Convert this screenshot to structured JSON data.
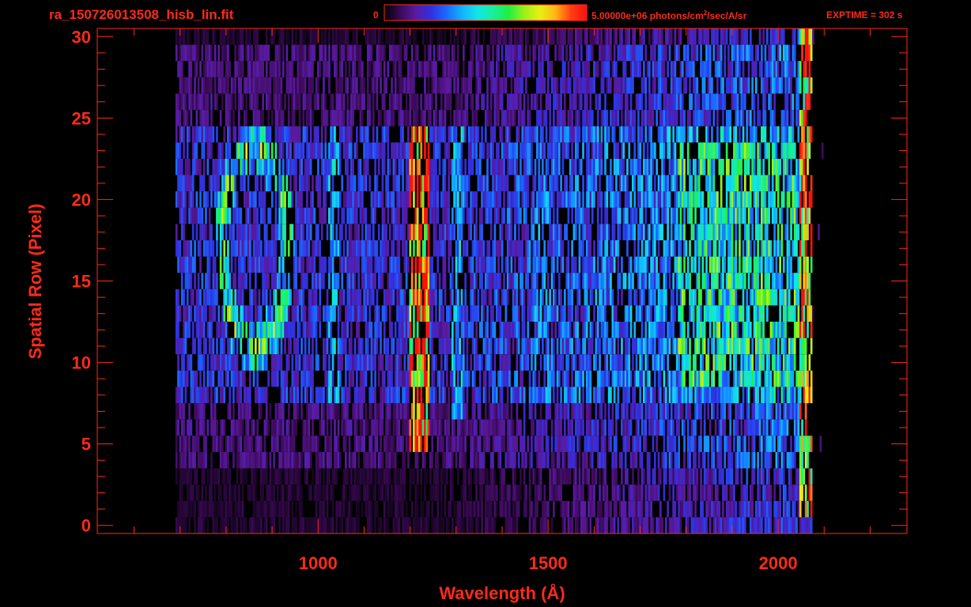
{
  "header": {
    "file_title": "ra_150726013508_hisb_lin.fit",
    "colorbar_min": "0",
    "colorbar_max_value": "5.00000e+06 photons/cm",
    "colorbar_max_exp": "2",
    "colorbar_max_unit": "/sec/A/sr",
    "exptime": "EXPTIME = 302 s"
  },
  "colors": {
    "axis": "#ff2a1a",
    "background": "#000000",
    "colormap": [
      "#000000",
      "#3a0a55",
      "#5a1aa0",
      "#3030e0",
      "#1a6aff",
      "#12b4ff",
      "#10e6e6",
      "#18ee9a",
      "#20f040",
      "#9cf018",
      "#e8f012",
      "#ffb414",
      "#ff3d10",
      "#ff1010"
    ]
  },
  "chart_data": {
    "type": "heatmap",
    "title": "",
    "xlabel": "Wavelength (Å)",
    "ylabel": "Spatial Row (Pixel)",
    "xlim": [
      520,
      2280
    ],
    "ylim": [
      -0.5,
      30.5
    ],
    "xticks_major": [
      1000,
      1500,
      2000
    ],
    "xtick_labels": [
      "1000",
      "1500",
      "2000"
    ],
    "xticks_minor": [
      600,
      700,
      800,
      900,
      1100,
      1200,
      1300,
      1400,
      1600,
      1700,
      1800,
      1900,
      2100,
      2200
    ],
    "yticks_major": [
      0,
      5,
      10,
      15,
      20,
      25,
      30
    ],
    "ytick_labels": [
      "0",
      "5",
      "10",
      "15",
      "20",
      "25",
      "30"
    ],
    "color_range": [
      0,
      5000000
    ],
    "color_unit": "photons/cm²/sec/A/sr",
    "detector_wavelength_range": [
      690,
      2070
    ],
    "features": [
      {
        "label": "bright vertical emission band",
        "wavelength_range": [
          1195,
          1240
        ],
        "rows": [
          5,
          24
        ],
        "intensity": 0.95
      },
      {
        "label": "ring-shaped emission",
        "center_wavelength": 860,
        "center_row": 17,
        "radius_wavelength": 75,
        "radius_rows": 6.5,
        "intensity": 0.55
      },
      {
        "label": "vertical emission band",
        "wavelength_range": [
          1020,
          1045
        ],
        "rows": [
          8,
          24
        ],
        "intensity": 0.35
      },
      {
        "label": "vertical emission band",
        "wavelength_range": [
          1290,
          1315
        ],
        "rows": [
          7,
          24
        ],
        "intensity": 0.35
      },
      {
        "label": "vertical emission band",
        "wavelength_range": [
          1470,
          1500
        ],
        "rows": [
          8,
          23
        ],
        "intensity": 0.3
      },
      {
        "label": "broad emission",
        "wavelength_range": [
          1780,
          2050
        ],
        "rows": [
          9,
          23
        ],
        "intensity": 0.5
      },
      {
        "label": "bright edge strip",
        "wavelength_range": [
          2045,
          2070
        ],
        "rows": [
          1,
          30
        ],
        "intensity": 0.8
      }
    ]
  }
}
